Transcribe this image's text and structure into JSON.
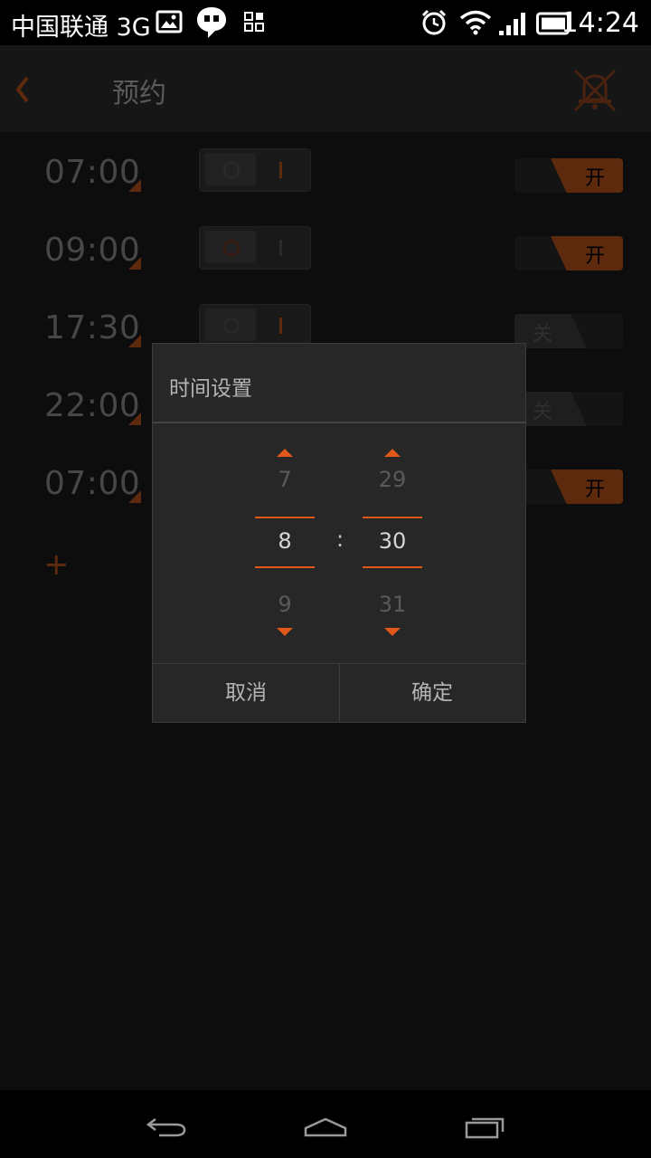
{
  "status_bar": {
    "carrier": "中国联通 3G",
    "time": "14:24",
    "icons": [
      "gallery-icon",
      "chat-icon",
      "apps-icon",
      "alarm-icon",
      "wifi-icon",
      "signal-icon",
      "battery-icon"
    ]
  },
  "app_bar": {
    "title": "预约",
    "back_icon": "chevron-left-icon",
    "action_icon": "mute-bell-icon"
  },
  "schedule": [
    {
      "time": "07:00",
      "toggle_label": "开",
      "enabled": true
    },
    {
      "time": "09:00",
      "toggle_label": "开",
      "enabled": true
    },
    {
      "time": "17:30",
      "toggle_label": "关",
      "enabled": false
    },
    {
      "time": "22:00",
      "toggle_label": "关",
      "enabled": false
    },
    {
      "time": "07:00",
      "toggle_label": "开",
      "enabled": true
    }
  ],
  "add_label": "+",
  "dialog": {
    "title": "时间设置",
    "hour": {
      "prev": "7",
      "current": "8",
      "next": "9"
    },
    "minute": {
      "prev": "29",
      "current": "30",
      "next": "31"
    },
    "separator": ":",
    "cancel_label": "取消",
    "ok_label": "确定"
  },
  "colors": {
    "accent": "#e0571a",
    "dialog_bg": "#272727",
    "background": "#0d0d0d"
  },
  "nav_icons": [
    "back-icon",
    "home-icon",
    "recents-icon"
  ]
}
